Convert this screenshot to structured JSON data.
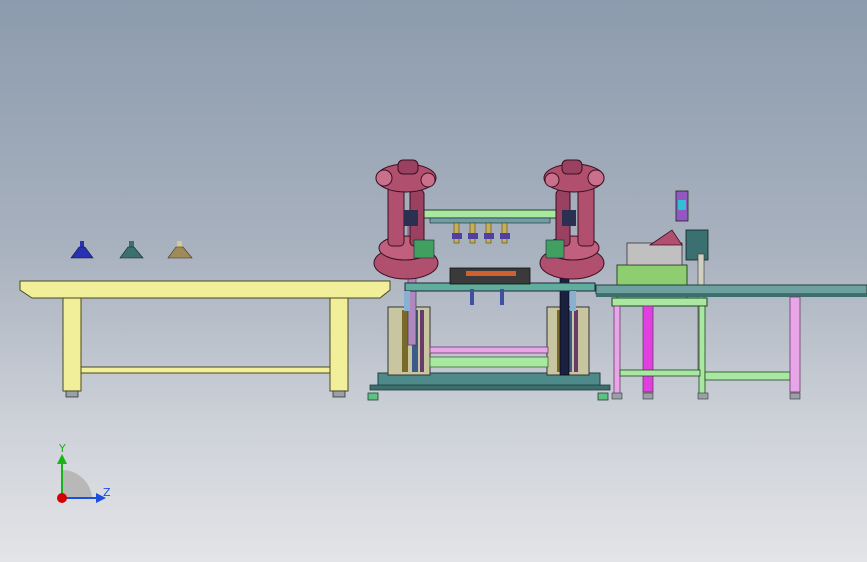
{
  "app": {
    "title": ""
  },
  "viewport": {
    "background_top": "#8c9bad",
    "background_bottom": "#e3e4e7"
  },
  "triad": {
    "y_label": "Y",
    "z_label": "Z",
    "x_color": "#d40000",
    "y_color": "#18b418",
    "z_color": "#1a4fe0"
  },
  "colors": {
    "table_top": "#f1ef9a",
    "robot": "#b0506e",
    "frame_green": "#a8e8a0",
    "frame_pink": "#e8a6e8",
    "conveyor": "#6fa0a0",
    "cup_blue": "#2830b4",
    "cup_teal": "#3c7070",
    "cup_tan": "#a08a58"
  },
  "parts": {
    "cups": [
      "blue-cup",
      "teal-cup",
      "tan-cup"
    ]
  }
}
